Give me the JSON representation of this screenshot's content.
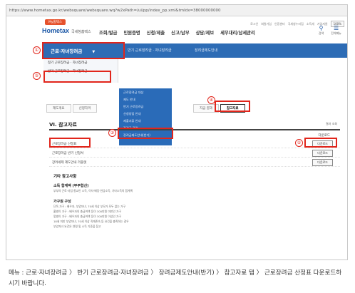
{
  "browser": {
    "url": "https://www.hometax.go.kr/websquare/websquare.wq?w2xPath=/ui/pp/index_pp.xml&tmIdx=38000000000"
  },
  "util": {
    "items": [
      "로그인",
      "회원가입",
      "인증센터",
      "국세청누리집",
      "빈칸",
      "소득세",
      "기업지원",
      "일반국세"
    ],
    "zoom": "100%"
  },
  "brand": {
    "badge": "My홈택스",
    "logo": "Hometax",
    "logo_sub": "국세청홈택스"
  },
  "topnav": [
    "조회/발급",
    "민원증명",
    "신청/제출",
    "신고/납부",
    "상담/제보",
    "세무대리/납세관리"
  ],
  "right_icons": [
    {
      "icon": "search-icon",
      "label": "검색"
    },
    {
      "icon": "menu-icon",
      "label": "전체메뉴"
    }
  ],
  "menubar": {
    "active": "근로·자녀장려금",
    "arrow": "▼",
    "m2": "반기 근로장려금 · 자녀장려금",
    "m3": "장려금제도안내",
    "m4": ""
  },
  "leftmenu": [
    "정기 근로장려금 · 자녀장려금",
    "반기 근로장려금 · 자녀장려금"
  ],
  "dropdown": [
    "근로장려금 대상",
    "제도 안내",
    "반기 근로장려금",
    "신청방법 안내",
    "제출서류 안내",
    "장려금 관련",
    "장려금제도안내(반기)"
  ],
  "tabs_left": [
    "제도개요",
    "신청자격"
  ],
  "tabs_right": [
    {
      "label": "지급 결과",
      "active": false
    },
    {
      "label": "참고자료",
      "active": true
    }
  ],
  "section": {
    "title": "VI. 참고자료",
    "paging": "결과 조회"
  },
  "table": {
    "header": "다운로드",
    "rows": [
      {
        "title": "근로장려금 산정표",
        "download": "다운로드"
      },
      {
        "title": "근로장려금 반기 신청서",
        "download": "다운로드"
      },
      {
        "title": "장려세제 제도안내 리플렛",
        "download": "다운로드"
      }
    ]
  },
  "info": {
    "h1": "기타 참고사항",
    "h2": "소득 합계액 (부부합산)",
    "l1": "부부의 근로·사업·종교인 소득, 이자·배당·연금소득, 기타소득의 합계액",
    "h3": "가구원 구성",
    "l2": "단독 가구 : 배우자, 부양자녀, 70세 이상 부모가 모두 없는 가구",
    "l3": "홑벌이 가구 : 배우자의 총급여액 등이 300만원 미만인 가구",
    "l4": "맞벌이 가구 : 배우자의 총급여액 등이 300만원 이상인 가구",
    "l5": "18세 미만 부양자녀, 70세 이상 직계존속 등 요건을 충족하는 경우",
    "l6": "부양자녀 요건은 연령 및 소득 기준을 참고"
  },
  "callouts": [
    "①",
    "②",
    "③",
    "④",
    "⑤"
  ],
  "caption": "메뉴 : 근로·자녀장려금 〉 반기 근로장려금·자녀장려금 〉 장려금제도안내(반기) 〉 참고자료 탭 〉 근로장려금 산정표 다운로드하시기 바랍니다."
}
